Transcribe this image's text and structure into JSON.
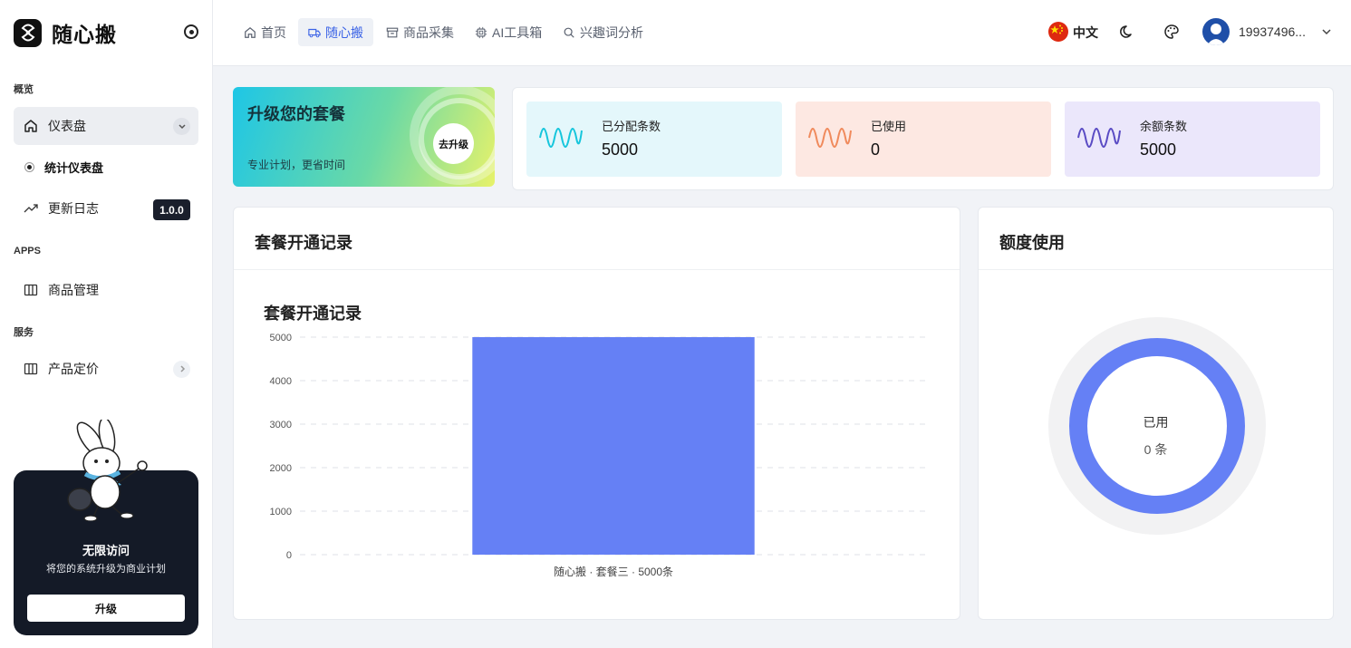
{
  "app": {
    "name": "随心搬"
  },
  "sidebar": {
    "sections": {
      "overview": "概览",
      "apps": "APPS",
      "services": "服务"
    },
    "items": [
      {
        "label": "仪表盘",
        "icon": "home-icon"
      },
      {
        "label": "统计仪表盘"
      },
      {
        "label": "更新日志",
        "icon": "trending-icon",
        "badge": "1.0.0"
      },
      {
        "label": "商品管理",
        "icon": "columns-icon"
      },
      {
        "label": "产品定价",
        "icon": "columns-icon"
      }
    ],
    "promo": {
      "title": "无限访问",
      "subtitle": "将您的系统升级为商业计划",
      "button": "升级"
    }
  },
  "topbar": {
    "tabs": [
      {
        "label": "首页",
        "icon": "home-icon"
      },
      {
        "label": "随心搬",
        "icon": "truck-icon",
        "active": true
      },
      {
        "label": "商品采集",
        "icon": "archive-icon"
      },
      {
        "label": "AI工具箱",
        "icon": "chip-icon"
      },
      {
        "label": "兴趣词分析",
        "icon": "search-icon"
      }
    ],
    "language": "中文",
    "user": "19937496..."
  },
  "upgrade": {
    "title": "升级您的套餐",
    "subtitle": "专业计划，更省时间",
    "button": "去升级"
  },
  "stats": [
    {
      "label": "已分配条数",
      "value": "5000",
      "color": "#16c6dc",
      "bg": "#e4f7fb"
    },
    {
      "label": "已使用",
      "value": "0",
      "color": "#f08a5c",
      "bg": "#fde8e2"
    },
    {
      "label": "余额条数",
      "value": "5000",
      "color": "#5a4bc4",
      "bg": "#ebe7fb"
    }
  ],
  "records_panel": {
    "title": "套餐开通记录"
  },
  "quota_panel": {
    "title": "额度使用",
    "center_label": "已用",
    "center_value": "0 条"
  },
  "chart_data": {
    "type": "bar",
    "title": "套餐开通记录",
    "categories": [
      "随心搬 · 套餐三 · 5000条"
    ],
    "values": [
      5000
    ],
    "yticks": [
      0,
      1000,
      2000,
      3000,
      4000,
      5000
    ],
    "ylim": [
      0,
      5000
    ],
    "grid": true,
    "bar_color": "#6580f5"
  },
  "donut": {
    "used": 0,
    "total": 5000,
    "ring_color": "#6580f5"
  }
}
